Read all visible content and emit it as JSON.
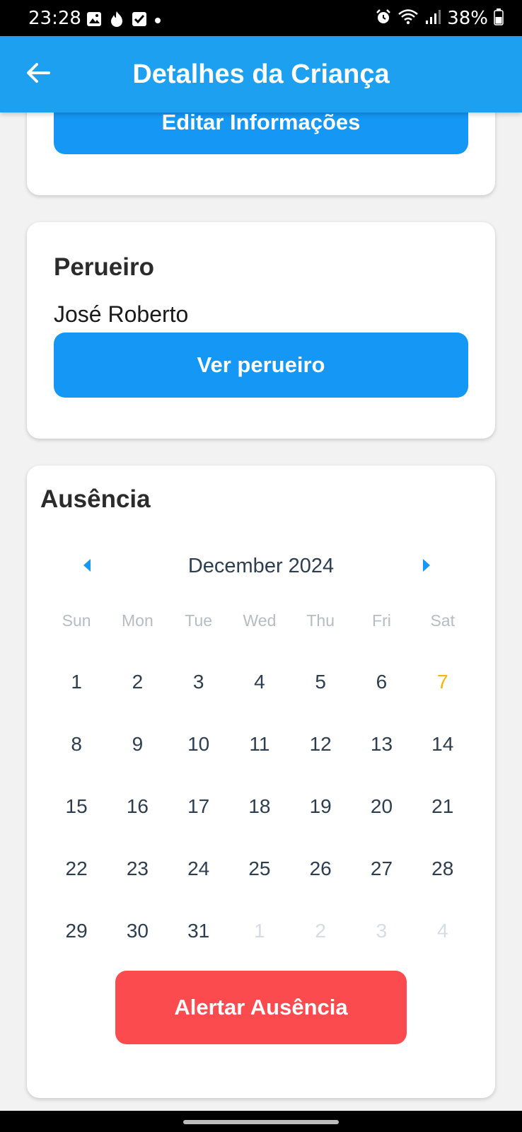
{
  "status_bar": {
    "time": "23:28",
    "battery": "38%",
    "left_icons": [
      "gallery-icon",
      "tinder-flame-icon",
      "checkbox-icon",
      "dot-icon"
    ],
    "right_icons": [
      "alarm-icon",
      "wifi-icon",
      "signal-icon",
      "battery-icon"
    ]
  },
  "app_bar": {
    "title": "Detalhes da Criança",
    "back_icon": "arrow-left-icon"
  },
  "child_card": {
    "edit_button_label": "Editar Informações"
  },
  "driver_card": {
    "heading": "Perueiro",
    "driver_name": "José Roberto",
    "view_button_label": "Ver perueiro"
  },
  "absence_card": {
    "heading": "Ausência",
    "calendar": {
      "month_label": "December 2024",
      "prev_icon": "caret-left-icon",
      "next_icon": "caret-right-icon",
      "weekdays": [
        "Sun",
        "Mon",
        "Tue",
        "Wed",
        "Thu",
        "Fri",
        "Sat"
      ],
      "days": [
        {
          "label": "1",
          "state": "current"
        },
        {
          "label": "2",
          "state": "current"
        },
        {
          "label": "3",
          "state": "current"
        },
        {
          "label": "4",
          "state": "current"
        },
        {
          "label": "5",
          "state": "current"
        },
        {
          "label": "6",
          "state": "current"
        },
        {
          "label": "7",
          "state": "today"
        },
        {
          "label": "8",
          "state": "current"
        },
        {
          "label": "9",
          "state": "current"
        },
        {
          "label": "10",
          "state": "current"
        },
        {
          "label": "11",
          "state": "current"
        },
        {
          "label": "12",
          "state": "current"
        },
        {
          "label": "13",
          "state": "current"
        },
        {
          "label": "14",
          "state": "current"
        },
        {
          "label": "15",
          "state": "current"
        },
        {
          "label": "16",
          "state": "current"
        },
        {
          "label": "17",
          "state": "current"
        },
        {
          "label": "18",
          "state": "current"
        },
        {
          "label": "19",
          "state": "current"
        },
        {
          "label": "20",
          "state": "current"
        },
        {
          "label": "21",
          "state": "current"
        },
        {
          "label": "22",
          "state": "current"
        },
        {
          "label": "23",
          "state": "current"
        },
        {
          "label": "24",
          "state": "current"
        },
        {
          "label": "25",
          "state": "current"
        },
        {
          "label": "26",
          "state": "current"
        },
        {
          "label": "27",
          "state": "current"
        },
        {
          "label": "28",
          "state": "current"
        },
        {
          "label": "29",
          "state": "current"
        },
        {
          "label": "30",
          "state": "current"
        },
        {
          "label": "31",
          "state": "current"
        },
        {
          "label": "1",
          "state": "other"
        },
        {
          "label": "2",
          "state": "other"
        },
        {
          "label": "3",
          "state": "other"
        },
        {
          "label": "4",
          "state": "other"
        }
      ]
    },
    "alert_button_label": "Alertar Ausência"
  },
  "colors": {
    "app_bar": "#1ea0f0",
    "primary_button": "#1497f5",
    "alert_button": "#fb4b4e",
    "today_highlight": "#f2b705",
    "calendar_arrow": "#1497f5"
  }
}
